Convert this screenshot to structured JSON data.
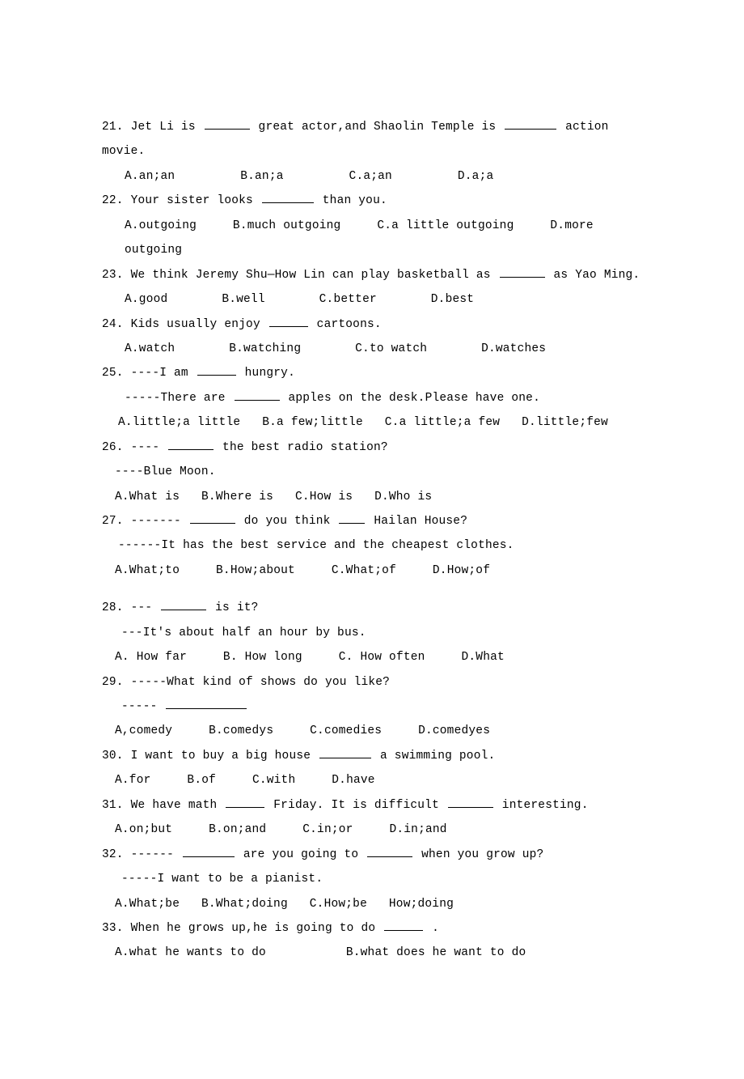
{
  "q21": {
    "num": "21. ",
    "t1": "Jet Li is",
    "t2": "great actor,and Shaolin Temple is",
    "t3": "action movie.",
    "a": "A.an;an",
    "b": "B.an;a",
    "c": "C.a;an",
    "d": "D.a;a"
  },
  "q22": {
    "num": "22.",
    "t1": "Your sister looks",
    "t2": "than you.",
    "a": "A.outgoing",
    "b": "B.much outgoing",
    "c": "C.a little outgoing",
    "d": "D.more outgoing"
  },
  "q23": {
    "num": "23.",
    "t1": "We think Jeremy Shu—How Lin can play basketball as",
    "t2": "as Yao Ming.",
    "a": "A.good",
    "b": "B.well",
    "c": "C.better",
    "d": "D.best"
  },
  "q24": {
    "num": "24.",
    "t1": "Kids usually enjoy",
    "t2": "cartoons.",
    "a": "A.watch",
    "b": "B.watching",
    "c": "C.to watch",
    "d": "D.watches"
  },
  "q25": {
    "num": "25.",
    "t1": "----I am",
    "t2": "hungry.",
    "t3": "-----There are",
    "t4": "apples on the desk.Please have one.",
    "a": "A.little;a little",
    "b": "B.a few;little",
    "c": "C.a little;a few",
    "d": "D.little;few"
  },
  "q26": {
    "num": "26.",
    "t1": "----",
    "t2": "the best radio station?",
    "t3": "----Blue Moon.",
    "a": "A.What is",
    "b": "B.Where is",
    "c": "C.How is",
    "d": "D.Who is"
  },
  "q27": {
    "num": "27.",
    "t1": "-------",
    "t2": "do you think",
    "t3": "Hailan House?",
    "t4": "------It has the best service and the cheapest clothes.",
    "a": "A.What;to",
    "b": "B.How;about",
    "c": "C.What;of",
    "d": "D.How;of"
  },
  "q28": {
    "num": "28.",
    "t1": "---",
    "t2": " is it?",
    "t3": "---It's about half an hour by bus.",
    "a": "A. How far",
    "b": "B. How long",
    "c": "C. How often",
    "d": "D.What"
  },
  "q29": {
    "num": "29.",
    "t1": "-----What kind of shows do you like?",
    "t2": "-----",
    "a": "A,comedy",
    "b": "B.comedys",
    "c": "C.comedies",
    "d": "D.comedyes"
  },
  "q30": {
    "num": "30.",
    "t1": "I want to buy a big house",
    "t2": "a swimming pool.",
    "a": "A.for",
    "b": "B.of",
    "c": "C.with",
    "d": "D.have"
  },
  "q31": {
    "num": "31.",
    "t1": "We have math ",
    "t2": "Friday. It is difficult",
    "t3": "interesting.",
    "a": "A.on;but",
    "b": "B.on;and",
    "c": "C.in;or",
    "d": "D.in;and"
  },
  "q32": {
    "num": "32.",
    "t1": "------",
    "t2": "are you going to",
    "t3": "when you grow up?",
    "t4": "-----I want to be a pianist.",
    "a": "A.What;be",
    "b": "B.What;doing",
    "c": "C.How;be",
    "d": "How;doing"
  },
  "q33": {
    "num": "33.",
    "t1": "When he grows up,he is going to do",
    "t2": ".",
    "a": "A.what he wants to do",
    "b": "B.what does he want to do"
  }
}
